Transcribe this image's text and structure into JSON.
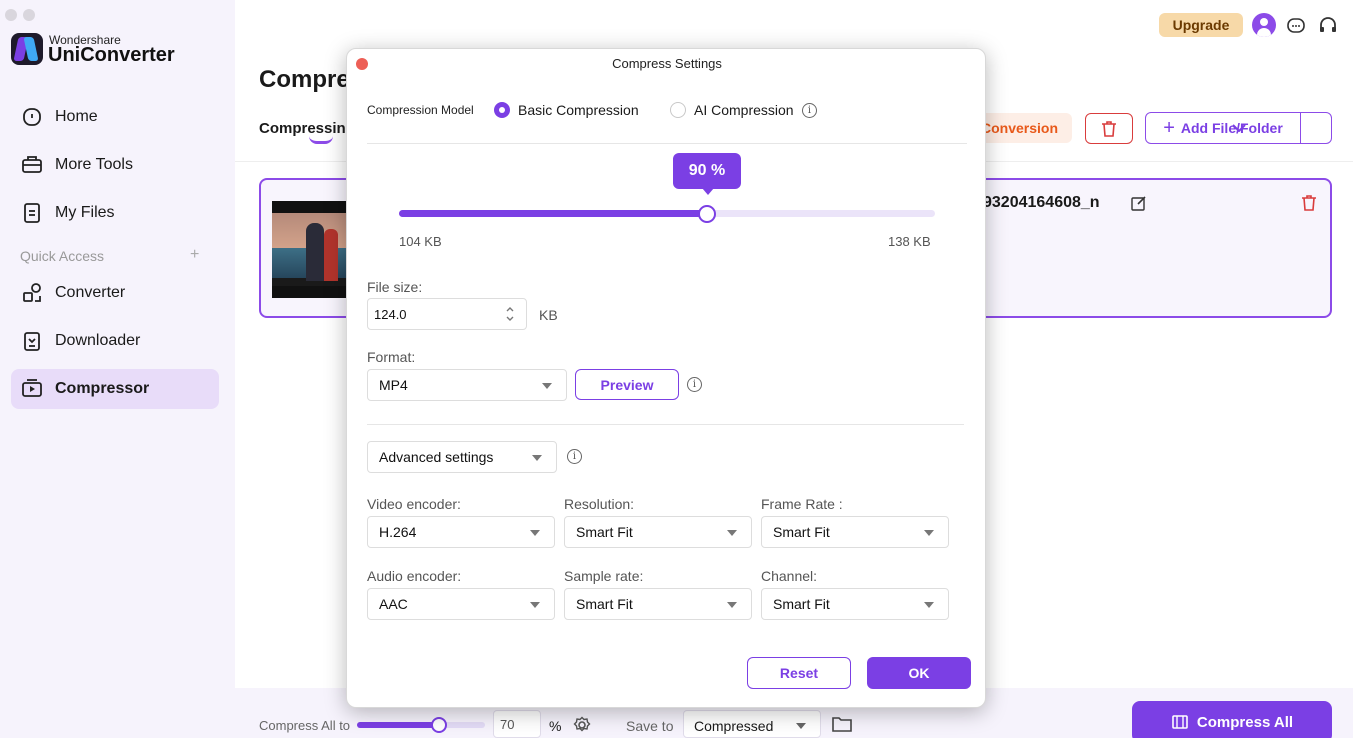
{
  "app": {
    "brand_small": "Wondershare",
    "brand_name": "UniConverter"
  },
  "sidebar": {
    "items": [
      {
        "label": "Home",
        "icon": "home-icon"
      },
      {
        "label": "More Tools",
        "icon": "toolbox-icon"
      },
      {
        "label": "My Files",
        "icon": "file-icon"
      },
      {
        "label": "Converter",
        "icon": "converter-icon"
      },
      {
        "label": "Downloader",
        "icon": "download-icon"
      },
      {
        "label": "Compressor",
        "icon": "compressor-icon"
      }
    ],
    "quick_access": "Quick Access",
    "quick_access_add": "+"
  },
  "header": {
    "upgrade": "Upgrade"
  },
  "main": {
    "title": "Compre",
    "tab": "Compressin",
    "conversion_btn": "Conversion",
    "add_file": "Add File/Folder",
    "file_name": "93204164608_n"
  },
  "bottom": {
    "compress_all_to": "Compress All to",
    "slider_value": 70,
    "value_text": "70",
    "percent": "%",
    "save_to": "Save to",
    "save_location": "Compressed",
    "compress_all": "Compress All"
  },
  "dialog": {
    "title": "Compress Settings",
    "compression_model_label": "Compression Model",
    "basic": "Basic Compression",
    "ai": "AI Compression",
    "slider_label": "90 %",
    "slider_fraction": 0.575,
    "min_size": "104 KB",
    "max_size": "138 KB",
    "file_size_label": "File size:",
    "file_size_value": "124.0",
    "file_size_unit": "KB",
    "format_label": "Format:",
    "format_value": "MP4",
    "preview": "Preview",
    "advanced": "Advanced settings",
    "video_encoder_label": "Video encoder:",
    "video_encoder": "H.264",
    "resolution_label": "Resolution:",
    "resolution": "Smart Fit",
    "frame_rate_label": "Frame Rate :",
    "frame_rate": "Smart Fit",
    "audio_encoder_label": "Audio encoder:",
    "audio_encoder": "AAC",
    "sample_rate_label": "Sample rate:",
    "sample_rate": "Smart Fit",
    "channel_label": "Channel:",
    "channel": "Smart Fit",
    "reset": "Reset",
    "ok": "OK"
  },
  "colors": {
    "accent": "#7b3fe4",
    "sidebar_bg": "#f6f3fc",
    "active_bg": "#e8dcf9",
    "danger": "#d93c3c",
    "upgrade_bg": "#f7d9a8"
  }
}
